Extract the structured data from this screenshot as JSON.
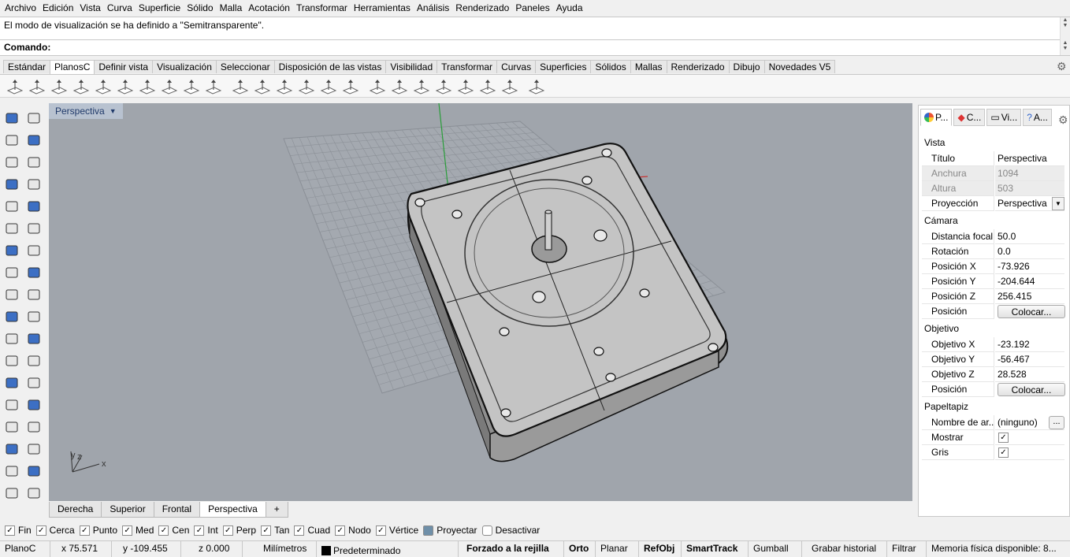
{
  "menu": [
    "Archivo",
    "Edición",
    "Vista",
    "Curva",
    "Superficie",
    "Sólido",
    "Malla",
    "Acotación",
    "Transformar",
    "Herramientas",
    "Análisis",
    "Renderizado",
    "Paneles",
    "Ayuda"
  ],
  "history_text": "El modo de visualización se ha definido a \"Semitransparente\".",
  "command_label": "Comando:",
  "command_value": "",
  "toolbar_tabs": [
    {
      "label": "Estándar",
      "active": false
    },
    {
      "label": "PlanosC",
      "active": true
    },
    {
      "label": "Definir vista",
      "active": false
    },
    {
      "label": "Visualización",
      "active": false
    },
    {
      "label": "Seleccionar",
      "active": false
    },
    {
      "label": "Disposición de las vistas",
      "active": false
    },
    {
      "label": "Visibilidad",
      "active": false
    },
    {
      "label": "Transformar",
      "active": false
    },
    {
      "label": "Curvas",
      "active": false
    },
    {
      "label": "Superficies",
      "active": false
    },
    {
      "label": "Sólidos",
      "active": false
    },
    {
      "label": "Mallas",
      "active": false
    },
    {
      "label": "Renderizado",
      "active": false
    },
    {
      "label": "Dibujo",
      "active": false
    },
    {
      "label": "Novedades V5",
      "active": false
    }
  ],
  "viewport": {
    "label": "Perspectiva",
    "axis_z": "z",
    "axis_y": "y",
    "axis_x": "x"
  },
  "viewport_tabs": [
    {
      "label": "Derecha",
      "active": false
    },
    {
      "label": "Superior",
      "active": false
    },
    {
      "label": "Frontal",
      "active": false
    },
    {
      "label": "Perspectiva",
      "active": true
    },
    {
      "label": "+",
      "active": false
    }
  ],
  "panel": {
    "tabs": [
      {
        "label": "P...",
        "icon": "properties-icon"
      },
      {
        "label": "C...",
        "icon": "layers-icon"
      },
      {
        "label": "Vi...",
        "icon": "display-icon"
      },
      {
        "label": "A...",
        "icon": "help-icon"
      }
    ],
    "sec_vista": "Vista",
    "titulo_k": "Título",
    "titulo_v": "Perspectiva",
    "anchura_k": "Anchura",
    "anchura_v": "1094",
    "altura_k": "Altura",
    "altura_v": "503",
    "proyeccion_k": "Proyección",
    "proyeccion_v": "Perspectiva",
    "sec_camara": "Cámara",
    "focal_k": "Distancia focal",
    "focal_v": "50.0",
    "rot_k": "Rotación",
    "rot_v": "0.0",
    "px_k": "Posición X",
    "px_v": "-73.926",
    "py_k": "Posición Y",
    "py_v": "-204.644",
    "pz_k": "Posición Z",
    "pz_v": "256.415",
    "pos_k": "Posición",
    "colocar": "Colocar...",
    "sec_objetivo": "Objetivo",
    "ox_k": "Objetivo X",
    "ox_v": "-23.192",
    "oy_k": "Objetivo Y",
    "oy_v": "-56.467",
    "oz_k": "Objetivo Z",
    "oz_v": "28.528",
    "sec_papel": "Papeltapiz",
    "nombre_k": "Nombre de ar...",
    "nombre_v": "(ninguno)",
    "nombre_btn": "...",
    "mostrar_k": "Mostrar",
    "gris_k": "Gris"
  },
  "osnaps": [
    {
      "label": "Fin",
      "checked": true
    },
    {
      "label": "Cerca",
      "checked": true
    },
    {
      "label": "Punto",
      "checked": true
    },
    {
      "label": "Med",
      "checked": true
    },
    {
      "label": "Cen",
      "checked": true
    },
    {
      "label": "Int",
      "checked": true
    },
    {
      "label": "Perp",
      "checked": true
    },
    {
      "label": "Tan",
      "checked": true
    },
    {
      "label": "Cuad",
      "checked": true
    },
    {
      "label": "Nodo",
      "checked": true
    },
    {
      "label": "Vértice",
      "checked": true
    },
    {
      "label": "Proyectar",
      "checked": false
    },
    {
      "label": "Desactivar",
      "checked": false
    }
  ],
  "status": {
    "cplane": "PlanoC",
    "x": "x 75.571",
    "y": "y -109.455",
    "z": "z 0.000",
    "units": "Milímetros",
    "layer": "Predeterminado",
    "grid_snap": "Forzado a la rejilla",
    "ortho": "Orto",
    "planar": "Planar",
    "osnap": "RefObj",
    "smarttrack": "SmartTrack",
    "gumball": "Gumball",
    "history": "Grabar historial",
    "filter": "Filtrar",
    "memory": "Memoria física disponible: 8..."
  },
  "colors": {
    "viewport_bg": "#a0a5ac",
    "grid": "#8d9299",
    "y_axis": "#2a9d3a",
    "x_axis": "#c83232"
  }
}
